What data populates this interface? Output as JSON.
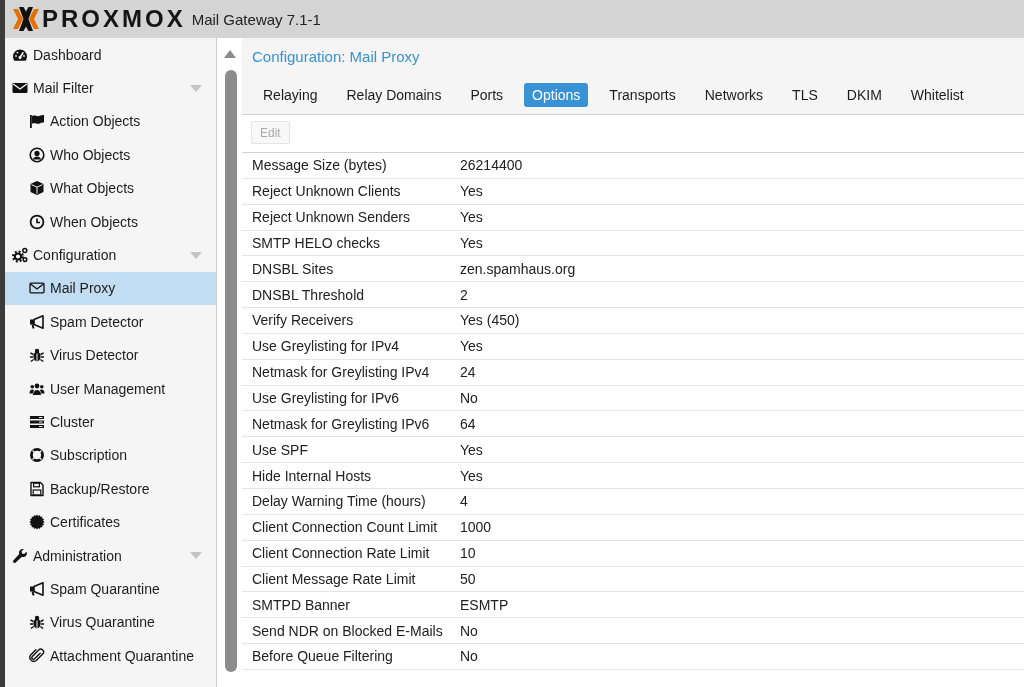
{
  "header": {
    "logo_text": "PROXMOX",
    "product": "Mail Gateway 7.1-1"
  },
  "sidebar": {
    "items": [
      {
        "label": "Dashboard",
        "selected": false
      },
      {
        "label": "Mail Filter",
        "selected": false,
        "expanded": true,
        "children": [
          {
            "label": "Action Objects",
            "selected": false
          },
          {
            "label": "Who Objects",
            "selected": false
          },
          {
            "label": "What Objects",
            "selected": false
          },
          {
            "label": "When Objects",
            "selected": false
          }
        ]
      },
      {
        "label": "Configuration",
        "selected": false,
        "expanded": true,
        "children": [
          {
            "label": "Mail Proxy",
            "selected": true
          },
          {
            "label": "Spam Detector",
            "selected": false
          },
          {
            "label": "Virus Detector",
            "selected": false
          },
          {
            "label": "User Management",
            "selected": false
          },
          {
            "label": "Cluster",
            "selected": false
          },
          {
            "label": "Subscription",
            "selected": false
          },
          {
            "label": "Backup/Restore",
            "selected": false
          },
          {
            "label": "Certificates",
            "selected": false
          }
        ]
      },
      {
        "label": "Administration",
        "selected": false,
        "expanded": true,
        "children": [
          {
            "label": "Spam Quarantine",
            "selected": false
          },
          {
            "label": "Virus Quarantine",
            "selected": false
          },
          {
            "label": "Attachment Quarantine",
            "selected": false
          }
        ]
      }
    ]
  },
  "content": {
    "title": "Configuration: Mail Proxy",
    "tabs": [
      {
        "label": "Relaying",
        "selected": false
      },
      {
        "label": "Relay Domains",
        "selected": false
      },
      {
        "label": "Ports",
        "selected": false
      },
      {
        "label": "Options",
        "selected": true
      },
      {
        "label": "Transports",
        "selected": false
      },
      {
        "label": "Networks",
        "selected": false
      },
      {
        "label": "TLS",
        "selected": false
      },
      {
        "label": "DKIM",
        "selected": false
      },
      {
        "label": "Whitelist",
        "selected": false
      }
    ],
    "toolbar": {
      "edit_button": {
        "label": "Edit",
        "disabled": true
      }
    },
    "table": {
      "rows": [
        {
          "name": "Message Size (bytes)",
          "value": "26214400"
        },
        {
          "name": "Reject Unknown Clients",
          "value": "Yes"
        },
        {
          "name": "Reject Unknown Senders",
          "value": "Yes"
        },
        {
          "name": "SMTP HELO checks",
          "value": "Yes"
        },
        {
          "name": "DNSBL Sites",
          "value": "zen.spamhaus.org"
        },
        {
          "name": "DNSBL Threshold",
          "value": "2"
        },
        {
          "name": "Verify Receivers",
          "value": "Yes (450)"
        },
        {
          "name": "Use Greylisting for IPv4",
          "value": "Yes"
        },
        {
          "name": "Netmask for Greylisting IPv4",
          "value": "24"
        },
        {
          "name": "Use Greylisting for IPv6",
          "value": "No"
        },
        {
          "name": "Netmask for Greylisting IPv6",
          "value": "64"
        },
        {
          "name": "Use SPF",
          "value": "Yes"
        },
        {
          "name": "Hide Internal Hosts",
          "value": "Yes"
        },
        {
          "name": "Delay Warning Time (hours)",
          "value": "4"
        },
        {
          "name": "Client Connection Count Limit",
          "value": "1000"
        },
        {
          "name": "Client Connection Rate Limit",
          "value": "10"
        },
        {
          "name": "Client Message Rate Limit",
          "value": "50"
        },
        {
          "name": "SMTPD Banner",
          "value": "ESMTP"
        },
        {
          "name": "Send NDR on Blocked E-Mails",
          "value": "No"
        },
        {
          "name": "Before Queue Filtering",
          "value": "No"
        }
      ]
    }
  }
}
